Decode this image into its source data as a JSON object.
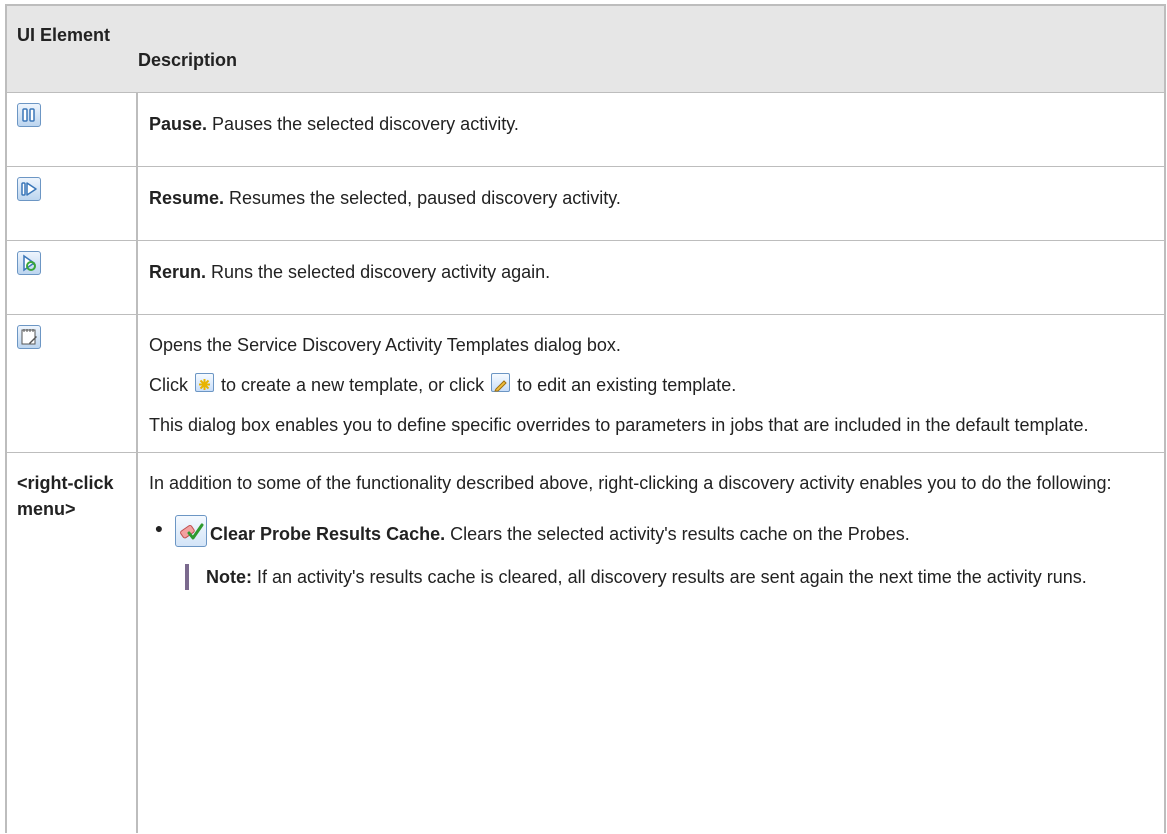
{
  "table": {
    "header": {
      "col1": "UI Element",
      "col2": "Description"
    },
    "rows": [
      {
        "icon": "pause-icon",
        "bold": "Pause.",
        "text": " Pauses the selected discovery activity."
      },
      {
        "icon": "resume-icon",
        "bold": "Resume.",
        "text": " Resumes the selected, paused discovery activity."
      },
      {
        "icon": "rerun-icon",
        "bold": "Rerun.",
        "text": " Runs the selected discovery activity again."
      },
      {
        "icon": "templates-icon",
        "line1": "Opens the Service Discovery Activity Templates dialog box.",
        "line2_a": "Click ",
        "line2_icon1": "new-template-icon",
        "line2_b": " to create a new template, or click ",
        "line2_icon2": "edit-template-icon",
        "line2_c": " to edit an existing template.",
        "line3": "This dialog box enables you to define specific overrides to parameters in jobs that are included in the default template."
      },
      {
        "label": "<right-click menu>",
        "intro": "In addition to some of the functionality described above, right-clicking a discovery activity enables you to do the following:",
        "bullet_icon": "clear-cache-icon",
        "bullet_bold": "Clear Probe Results Cache.",
        "bullet_text": " Clears the selected activity's results cache on the Probes.",
        "note_label": "Note:",
        "note_text": "  If an activity's results cache is cleared, all discovery results are sent again the next time the activity runs."
      }
    ]
  }
}
